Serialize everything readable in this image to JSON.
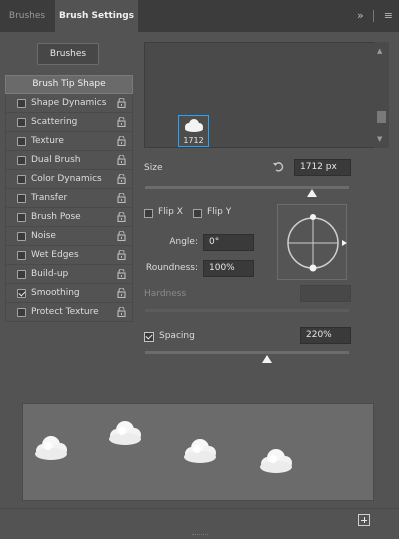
{
  "tabs": [
    {
      "label": "Brushes",
      "active": false
    },
    {
      "label": "Brush Settings",
      "active": true
    }
  ],
  "tab_icons": {
    "collapse": "»",
    "menu": "≡"
  },
  "brushes_button": "Brushes",
  "left_panel": {
    "selected": "Brush Tip Shape",
    "options": [
      {
        "label": "Shape Dynamics",
        "checked": false
      },
      {
        "label": "Scattering",
        "checked": false
      },
      {
        "label": "Texture",
        "checked": false
      },
      {
        "label": "Dual Brush",
        "checked": false
      },
      {
        "label": "Color Dynamics",
        "checked": false
      },
      {
        "label": "Transfer",
        "checked": false
      },
      {
        "label": "Brush Pose",
        "checked": false
      },
      {
        "label": "Noise",
        "checked": false
      },
      {
        "label": "Wet Edges",
        "checked": false
      },
      {
        "label": "Build-up",
        "checked": false
      },
      {
        "label": "Smoothing",
        "checked": true
      },
      {
        "label": "Protect Texture",
        "checked": false
      }
    ]
  },
  "tip": {
    "thumb_label": "1712"
  },
  "size": {
    "label": "Size",
    "value": "1712 px",
    "slider_level": 0.82
  },
  "flip": {
    "x_label": "Flip X",
    "y_label": "Flip Y",
    "x_checked": false,
    "y_checked": false
  },
  "angle": {
    "label": "Angle:",
    "value": "0°"
  },
  "roundness": {
    "label": "Roundness:",
    "value": "100%"
  },
  "hardness": {
    "label": "Hardness"
  },
  "spacing": {
    "label": "Spacing",
    "value": "220%",
    "checked": true,
    "slider_level": 0.6
  },
  "colors": {
    "panel": "#535353",
    "tab_bar": "#3c3c3c",
    "selection": "#29a3f5",
    "field": "#3a3a3a"
  },
  "icons": [
    "lock-icon",
    "reset-icon",
    "new-preset-icon",
    "menu-icon",
    "collapse-icon"
  ]
}
